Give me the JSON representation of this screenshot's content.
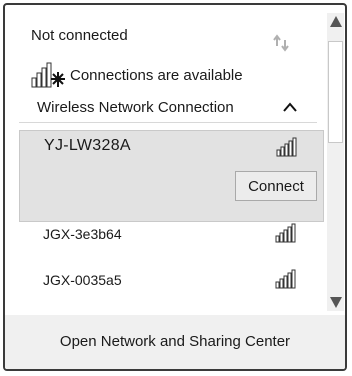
{
  "header": {
    "status": "Not connected",
    "availability": "Connections are available"
  },
  "section": {
    "title": "Wireless Network Connection"
  },
  "networks": [
    {
      "ssid": "YJ-LW328A",
      "selected": true,
      "action": "Connect"
    },
    {
      "ssid": "JGX-3e3b64",
      "selected": false
    },
    {
      "ssid": "JGX-0035a5",
      "selected": false
    }
  ],
  "footer": {
    "link": "Open Network and Sharing Center"
  },
  "icons": {
    "refresh": "refresh-icon",
    "availability": "wifi-available-icon",
    "collapse": "chevron-up-icon",
    "signal": "signal-bars-icon"
  },
  "colors": {
    "selected_row": "#e2e2e2",
    "footer_bg": "#f0f0f0",
    "text": "#1a1a1a"
  }
}
